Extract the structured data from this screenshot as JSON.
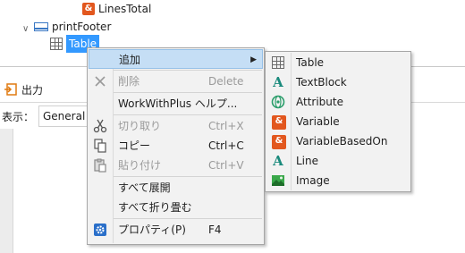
{
  "tree": {
    "item_lines_total": "LinesTotal",
    "item_print_footer": "printFooter",
    "item_table": "Table"
  },
  "output_panel": {
    "title": "出力",
    "view_label": "表示：",
    "view_value": "General"
  },
  "context_menu": {
    "items": [
      {
        "label": "追加",
        "shortcut": "",
        "enabled": true,
        "submenu": true
      },
      {
        "label": "削除",
        "shortcut": "Delete",
        "enabled": false
      },
      {
        "label": "WorkWithPlus ヘルプ...",
        "shortcut": "",
        "enabled": true
      },
      {
        "label": "切り取り",
        "shortcut": "Ctrl+X",
        "enabled": false
      },
      {
        "label": "コピー",
        "shortcut": "Ctrl+C",
        "enabled": true
      },
      {
        "label": "貼り付け",
        "shortcut": "Ctrl+V",
        "enabled": false
      },
      {
        "label": "すべて展開",
        "shortcut": "",
        "enabled": true
      },
      {
        "label": "すべて折り畳む",
        "shortcut": "",
        "enabled": true
      },
      {
        "label": "プロパティ(P)",
        "shortcut": "F4",
        "enabled": true
      }
    ]
  },
  "add_submenu": {
    "items": [
      {
        "label": "Table",
        "icon": "table-icon"
      },
      {
        "label": "TextBlock",
        "icon": "textblock-icon"
      },
      {
        "label": "Attribute",
        "icon": "attribute-icon"
      },
      {
        "label": "Variable",
        "icon": "variable-icon"
      },
      {
        "label": "VariableBasedOn",
        "icon": "variable-based-on-icon"
      },
      {
        "label": "Line",
        "icon": "line-icon"
      },
      {
        "label": "Image",
        "icon": "image-icon"
      }
    ]
  },
  "colors": {
    "selection": "#3399ff",
    "menu_highlight": "#c5def5",
    "variable_icon": "#e2571e",
    "textblock_icon": "#1a8a7c"
  }
}
